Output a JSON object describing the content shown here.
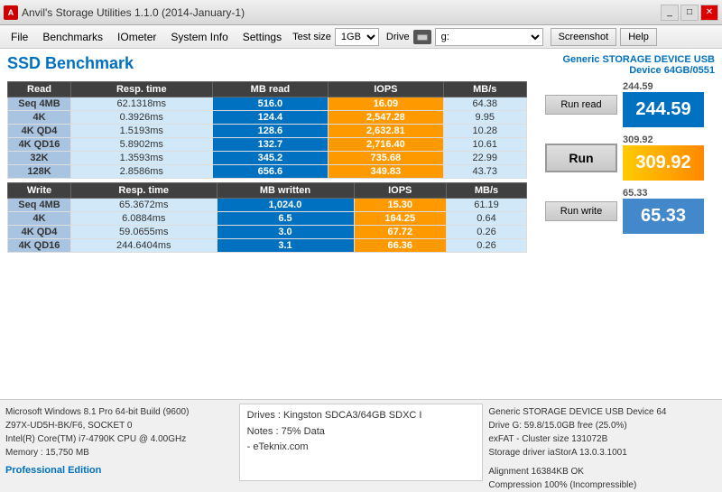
{
  "titleBar": {
    "title": "Anvil's Storage Utilities 1.1.0 (2014-January-1)",
    "icon": "A"
  },
  "menuBar": {
    "file": "File",
    "benchmarks": "Benchmarks",
    "iometer": "IOmeter",
    "systemInfo": "System Info",
    "settings": "Settings",
    "testSizeLabel": "Test size",
    "testSizeValue": "1GB",
    "driveLabel": "Drive",
    "driveValue": "g:",
    "screenshot": "Screenshot",
    "help": "Help"
  },
  "ssdBenchmark": {
    "title": "SSD Benchmark",
    "deviceLine1": "Generic STORAGE DEVICE USB",
    "deviceLine2": "Device 64GB/0551"
  },
  "readHeaders": [
    "Read",
    "Resp. time",
    "MB read",
    "IOPS",
    "MB/s"
  ],
  "readRows": [
    {
      "label": "Seq 4MB",
      "resp": "62.1318ms",
      "mb": "516.0",
      "iops": "16.09",
      "mbs": "64.38"
    },
    {
      "label": "4K",
      "resp": "0.3926ms",
      "mb": "124.4",
      "iops": "2,547.28",
      "mbs": "9.95"
    },
    {
      "label": "4K QD4",
      "resp": "1.5193ms",
      "mb": "128.6",
      "iops": "2,632.81",
      "mbs": "10.28"
    },
    {
      "label": "4K QD16",
      "resp": "5.8902ms",
      "mb": "132.7",
      "iops": "2,716.40",
      "mbs": "10.61"
    },
    {
      "label": "32K",
      "resp": "1.3593ms",
      "mb": "345.2",
      "iops": "735.68",
      "mbs": "22.99"
    },
    {
      "label": "128K",
      "resp": "2.8586ms",
      "mb": "656.6",
      "iops": "349.83",
      "mbs": "43.73"
    }
  ],
  "writeHeaders": [
    "Write",
    "Resp. time",
    "MB written",
    "IOPS",
    "MB/s"
  ],
  "writeRows": [
    {
      "label": "Seq 4MB",
      "resp": "65.3672ms",
      "mb": "1,024.0",
      "iops": "15.30",
      "mbs": "61.19"
    },
    {
      "label": "4K",
      "resp": "6.0884ms",
      "mb": "6.5",
      "iops": "164.25",
      "mbs": "0.64"
    },
    {
      "label": "4K QD4",
      "resp": "59.0655ms",
      "mb": "3.0",
      "iops": "67.72",
      "mbs": "0.26"
    },
    {
      "label": "4K QD16",
      "resp": "244.6404ms",
      "mb": "3.1",
      "iops": "66.36",
      "mbs": "0.26"
    }
  ],
  "gauges": {
    "runReadLabel": "Run read",
    "runReadValue": "244.59",
    "runLabel": "Run",
    "runValue": "309.92",
    "runWriteLabel": "Run write",
    "runWriteValue": "65.33"
  },
  "bottomBar": {
    "left": {
      "line1": "Microsoft Windows 8.1 Pro 64-bit Build (9600)",
      "line2": "Z97X-UD5H-BK/F6, SOCKET 0",
      "line3": "Intel(R) Core(TM) i7-4790K CPU @ 4.00GHz",
      "line4": "Memory : 15,750 MB",
      "proEdition": "Professional Edition"
    },
    "mid": {
      "line1": "Drives : Kingston SDCA3/64GB SDXC I",
      "line2": "Notes : 75% Data",
      "line3": "- eTeknix.com"
    },
    "right": {
      "line1": "Generic STORAGE DEVICE USB Device 64",
      "line2": "Drive G: 59.8/15.0GB free (25.0%)",
      "line3": "exFAT - Cluster size 131072B",
      "line4": "Storage driver iaStorA 13.0.3.1001",
      "line5": "",
      "line6": "Alignment 16384KB OK",
      "line7": "Compression 100% (Incompressible)"
    }
  }
}
